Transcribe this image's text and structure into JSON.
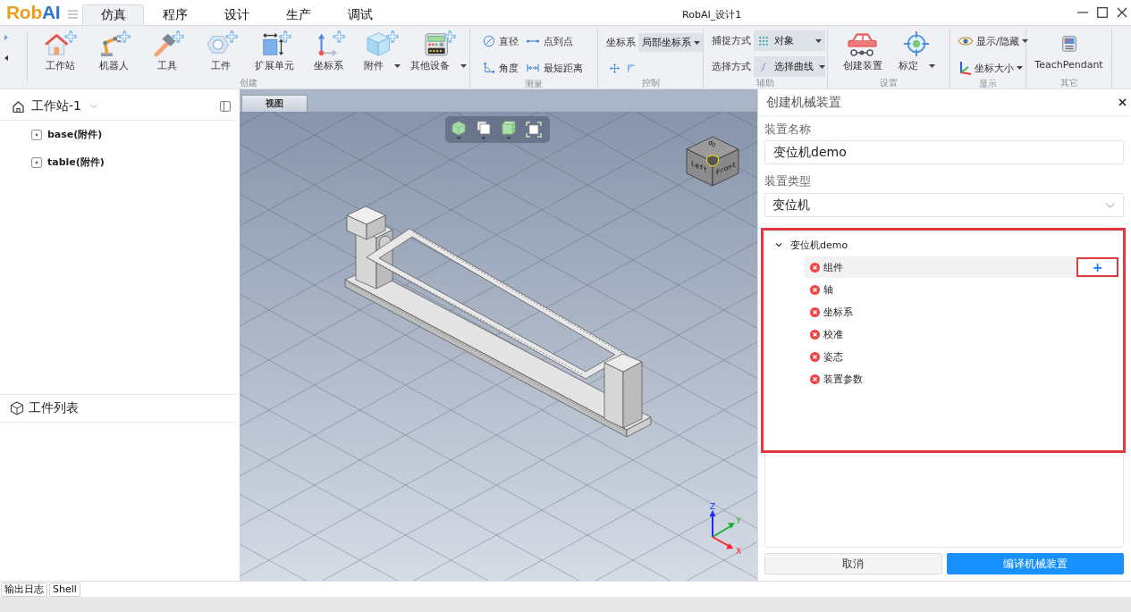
{
  "logo": {
    "text": "Rob",
    "accent": "AI"
  },
  "tabs": [
    {
      "label": "仿真",
      "selected": true
    },
    {
      "label": "程序",
      "selected": false
    },
    {
      "label": "设计",
      "selected": false
    },
    {
      "label": "生产",
      "selected": false
    },
    {
      "label": "调试",
      "selected": false
    }
  ],
  "window": {
    "title": "RobAI_设计1"
  },
  "ribbon": {
    "groups": [
      {
        "label": "创建",
        "kind": "large",
        "items": [
          {
            "label": "工作站",
            "dropdown": false
          },
          {
            "label": "机器人",
            "dropdown": false
          },
          {
            "label": "工具",
            "dropdown": false
          },
          {
            "label": "工件",
            "dropdown": false
          },
          {
            "label": "扩展单元",
            "dropdown": false
          },
          {
            "label": "坐标系",
            "dropdown": false
          },
          {
            "label": "附件",
            "dropdown": true
          },
          {
            "label": "其他设备",
            "dropdown": true
          }
        ]
      },
      {
        "label": "测量",
        "kind": "small-grid",
        "items": [
          {
            "label": "直径",
            "dropdown": false
          },
          {
            "label": "点到点",
            "dropdown": false
          },
          {
            "label": "角度",
            "dropdown": false
          },
          {
            "label": "最短距离",
            "dropdown": false
          }
        ]
      },
      {
        "label": "控制",
        "kind": "control",
        "fields": [
          {
            "label": "坐标系",
            "value": "局部坐标系"
          }
        ]
      },
      {
        "label": "辅助",
        "kind": "fields",
        "fields": [
          {
            "label": "捕捉方式",
            "value": "对象"
          },
          {
            "label": "选择方式",
            "value": "选择曲线"
          }
        ]
      },
      {
        "label": "设置",
        "kind": "large",
        "items": [
          {
            "label": "创建装置",
            "dropdown": false
          },
          {
            "label": "标定",
            "dropdown": true
          }
        ]
      },
      {
        "label": "显示",
        "kind": "small-list",
        "items": [
          {
            "label": "显示/隐藏",
            "dropdown": true
          },
          {
            "label": "坐标大小",
            "dropdown": true
          }
        ]
      },
      {
        "label": "其它",
        "kind": "large",
        "items": [
          {
            "label": "TeachPendant",
            "dropdown": false
          }
        ]
      }
    ]
  },
  "workstation_panel": {
    "title": "工作站-1",
    "items": [
      {
        "label": "base(附件)"
      },
      {
        "label": "table(附件)"
      }
    ]
  },
  "workpiece_list": {
    "title": "工件列表"
  },
  "viewport": {
    "tab": "视图",
    "view_cube_faces": [
      "Up",
      "Left",
      "Front"
    ],
    "axis_labels": [
      "Z",
      "Y",
      "X"
    ]
  },
  "device_panel": {
    "title": "创建机械装置",
    "fields": [
      {
        "label": "装置名称",
        "kind": "text",
        "value": "变位机demo"
      },
      {
        "label": "装置类型",
        "kind": "select",
        "value": "变位机"
      }
    ],
    "tree": {
      "highlighted": true,
      "root": {
        "label": "变位机demo",
        "expanded": true,
        "children": [
          {
            "label": "组件",
            "error": true,
            "selected": true,
            "add_button": {
              "label": "+",
              "highlighted": true
            }
          },
          {
            "label": "轴",
            "error": true,
            "selected": false
          },
          {
            "label": "坐标系",
            "error": true,
            "selected": false
          },
          {
            "label": "校准",
            "error": true,
            "selected": false
          },
          {
            "label": "姿态",
            "error": true,
            "selected": false
          },
          {
            "label": "装置参数",
            "error": true,
            "selected": false
          }
        ]
      }
    },
    "buttons": [
      {
        "label": "取消",
        "kind": "secondary"
      },
      {
        "label": "编译机械装置",
        "kind": "primary"
      }
    ]
  },
  "bottom_tabs": [
    {
      "label": "输出日志"
    },
    {
      "label": "Shell"
    }
  ]
}
